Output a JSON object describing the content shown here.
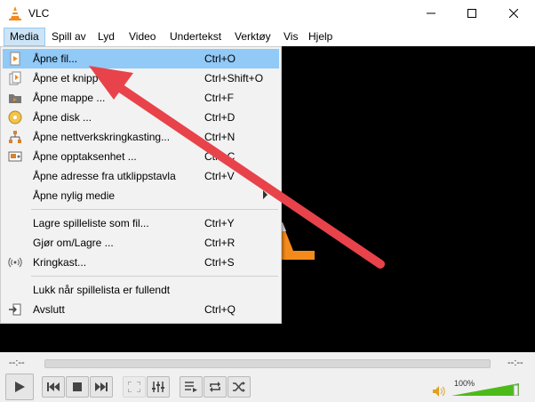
{
  "window": {
    "title": "VLC",
    "icon": "vlc-cone-icon"
  },
  "menubar": {
    "items": [
      "Media",
      "Spill av",
      "Lyd",
      "Video",
      "Undertekst",
      "Verktøy",
      "Vis",
      "Hjelp"
    ],
    "active": "Media"
  },
  "media_menu": {
    "items": [
      {
        "label": "Åpne fil...",
        "shortcut": "Ctrl+O",
        "icon": "open-file-icon",
        "highlighted": true
      },
      {
        "label": "Åpne et knipp filer...",
        "shortcut": "Ctrl+Shift+O",
        "icon": "open-files-icon"
      },
      {
        "label": "Åpne mappe ...",
        "shortcut": "Ctrl+F",
        "icon": "folder-icon"
      },
      {
        "label": "Åpne disk ...",
        "shortcut": "Ctrl+D",
        "icon": "disc-icon"
      },
      {
        "label": "Åpne nettverkskringkasting...",
        "shortcut": "Ctrl+N",
        "icon": "network-icon"
      },
      {
        "label": "Åpne opptaksenhet ...",
        "shortcut": "Ctrl+C",
        "icon": "capture-device-icon"
      },
      {
        "label": "Åpne adresse fra utklippstavla",
        "shortcut": "Ctrl+V",
        "icon": ""
      },
      {
        "label": "Åpne nylig medie",
        "shortcut": "",
        "icon": "",
        "submenu": true
      },
      {
        "label": "Lagre spilleliste som fil...",
        "shortcut": "Ctrl+Y",
        "icon": ""
      },
      {
        "label": "Gjør om/Lagre ...",
        "shortcut": "Ctrl+R",
        "icon": ""
      },
      {
        "label": "Kringkast...",
        "shortcut": "Ctrl+S",
        "icon": "broadcast-icon"
      },
      {
        "label": "Lukk når spillelista er fullendt",
        "shortcut": "",
        "icon": ""
      },
      {
        "label": "Avslutt",
        "shortcut": "Ctrl+Q",
        "icon": "exit-icon"
      }
    ]
  },
  "controls": {
    "elapsed": "--:--",
    "remaining": "--:--",
    "volume_label": "100%",
    "volume_level": 1.0,
    "buttons": [
      "play-icon",
      "previous-icon",
      "stop-icon",
      "next-icon",
      "fullscreen-icon",
      "extended-settings-icon",
      "playlist-icon",
      "loop-icon",
      "shuffle-icon"
    ]
  },
  "colors": {
    "menu_highlight": "#91c9f7",
    "annotation_arrow": "#e8434a",
    "volume_green": "#4cbb17"
  }
}
